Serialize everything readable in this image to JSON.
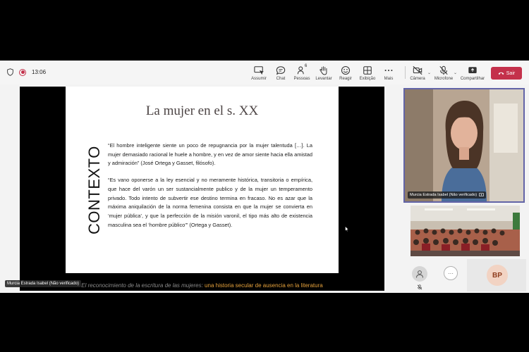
{
  "toolbar": {
    "timer": "13:06",
    "buttons": {
      "react_people_count": "6",
      "assumir": "Assumir",
      "chat": "Chat",
      "pessoas": "Pessoas",
      "levantar": "Levantar",
      "reagir": "Reagir",
      "exibicao": "Exibição",
      "mais": "Mais",
      "camera": "Câmera",
      "microfone": "Microfone",
      "compartilhar": "Compartilhar",
      "sair": "Sair"
    }
  },
  "slide": {
    "title": "La mujer en el s. XX",
    "side_title": "CONTEXTO",
    "quote1": "“El hombre inteligente siente un poco de repugnancia por la mujer talentuda […]. La mujer demasiado racional le huele a hombre, y en vez de amor siente hacia ella amistad y admiración” (José Ortega y Gasset, filósofo).",
    "quote2": "“Es vano oponerse a la ley esencial y no meramente histórica, transitoria o empírica, que hace del varón un ser sustancialmente publico y de la mujer un temperamento privado. Todo intento de subvertir ese destino termina en fracaso. No es azar que la máxima aniquilación de la norma femenina consista en que la mujer se convierta en ‘mujer pública’, y que la perfección de la misión varonil, el tipo más alto de existencia masculina sea el ‘hombre público’” (Ortega y Gasset)."
  },
  "caption": {
    "part1": "El reconocimiento de la escritura de las mujeres: ",
    "part2": "una historia secular de ausencia en la literatura"
  },
  "presenter": {
    "name_bar": "Murcia Estrada Isabel (Não verificado)",
    "tile_name": "Murcia Estrada Isabel (Não verificado)"
  },
  "participants": {
    "more_label": "···",
    "bp_initials": "BP"
  },
  "colors": {
    "leave": "#c4314b",
    "active_speaker_border": "#6264a7",
    "caption_highlight": "#e6a23c"
  }
}
